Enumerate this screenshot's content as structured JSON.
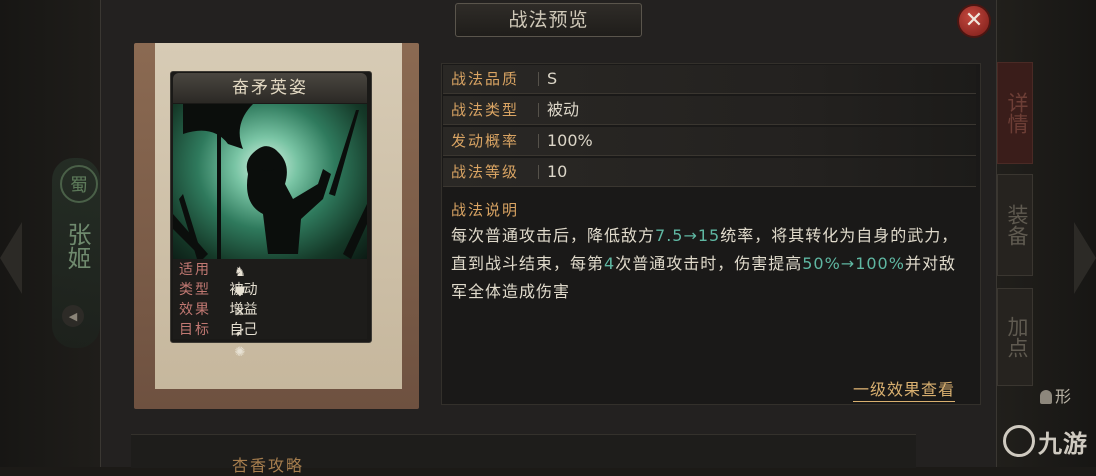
{
  "dialog": {
    "title": "战法预览",
    "close_label": "✕"
  },
  "character": {
    "faction": "蜀",
    "name": "张姬"
  },
  "side_tabs": [
    "详情",
    "装备",
    "加点"
  ],
  "side_player_label": "形",
  "card": {
    "name": "奋矛英姿",
    "props": [
      {
        "key": "适用",
        "value": ""
      },
      {
        "key": "类型",
        "value": "被动"
      },
      {
        "key": "效果",
        "value": "增益"
      },
      {
        "key": "目标",
        "value": "自己"
      }
    ],
    "unit_icons": [
      "cavalry-icon",
      "shield-icon",
      "bow-icon",
      "spear-icon",
      "siege-icon"
    ]
  },
  "info": {
    "rows": [
      {
        "key": "战法品质",
        "value": "S"
      },
      {
        "key": "战法类型",
        "value": "被动"
      },
      {
        "key": "发动概率",
        "value": "100%"
      },
      {
        "key": "战法等级",
        "value": "10"
      }
    ],
    "desc_title": "战法说明",
    "desc": [
      {
        "text": "每次普通攻击后，降低敌方"
      },
      {
        "text": "7.5→15",
        "hl": true
      },
      {
        "text": "统率，将其转化为自身的武力，直到战斗结束，每第"
      },
      {
        "text": "4",
        "hl": true
      },
      {
        "text": "次普通攻击时，伤害提高"
      },
      {
        "text": "50%→100%",
        "hl": true
      },
      {
        "text": "并对敌军全体造成伤害"
      }
    ],
    "level_link": "一级效果查看"
  },
  "bottom_label": "杏香攻略",
  "watermark": "九游",
  "colors": {
    "accent_gold": "#d9a463",
    "highlight_teal": "#5fb7a2",
    "close_red": "#a8322a"
  }
}
